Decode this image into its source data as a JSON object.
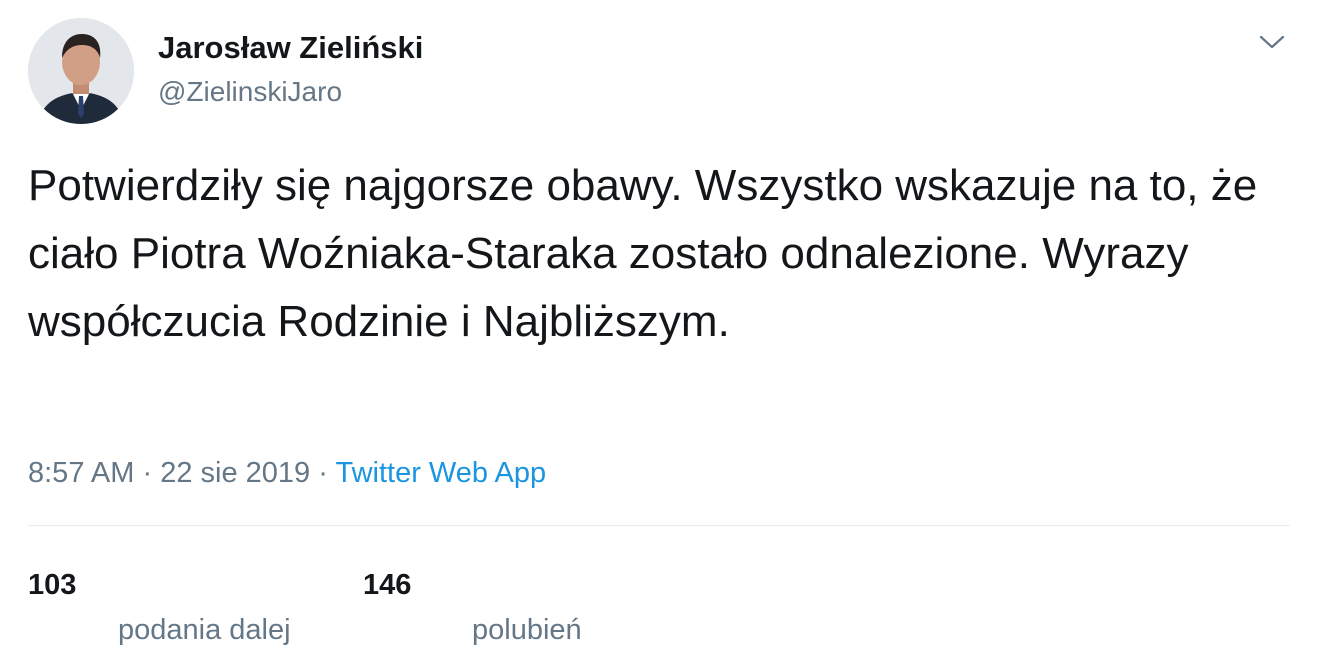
{
  "author": {
    "display_name": "Jarosław Zieliński",
    "handle": "@ZielinskiJaro",
    "avatar_icon": "profile-photo"
  },
  "tweet": {
    "text": "Potwierdziły się najgorsze obawy. Wszystko wskazuje na to, że ciało Piotra Woźniaka-Staraka zostało odnalezione. Wyrazy współczucia Rodzinie i Najbliższym.",
    "time": "8:57 AM",
    "separator": "·",
    "date": "22 sie 2019",
    "source": "Twitter Web App"
  },
  "stats": {
    "retweets_count": "103",
    "retweets_label": "podania dalej",
    "likes_count": "146",
    "likes_label": "polubień"
  },
  "icons": {
    "menu": "chevron-down-icon"
  },
  "colors": {
    "text_primary": "#14171a",
    "text_secondary": "#657786",
    "link": "#1b95e0",
    "divider": "#e6ecf0"
  }
}
